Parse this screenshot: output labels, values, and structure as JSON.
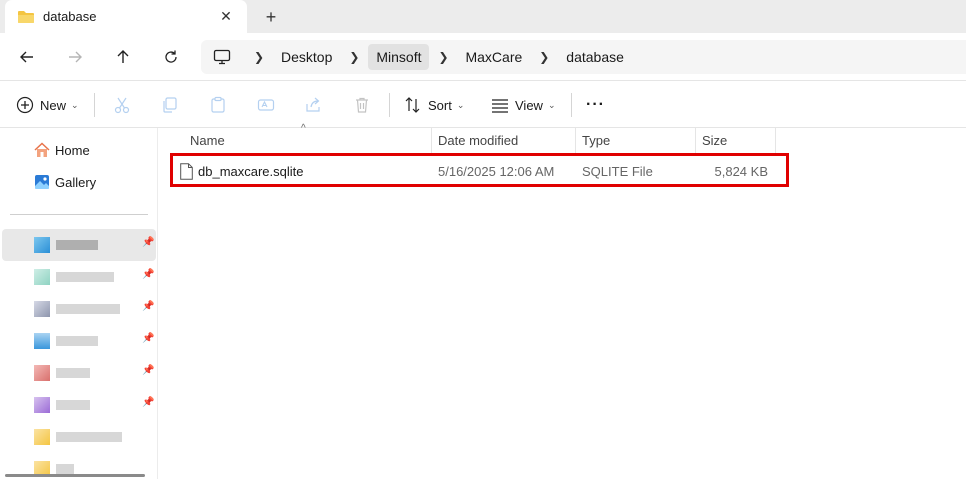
{
  "tab": {
    "title": "database",
    "close_icon": "close-icon",
    "new_tab_icon": "plus-icon"
  },
  "nav": {
    "back_icon": "arrow-left-icon",
    "forward_icon": "arrow-right-icon",
    "up_icon": "arrow-up-icon",
    "refresh_icon": "refresh-icon",
    "breadcrumbs": [
      "Desktop",
      "Minsoft",
      "MaxCare",
      "database"
    ]
  },
  "commands": {
    "new_label": "New",
    "sort_label": "Sort",
    "view_label": "View",
    "more_label": "···"
  },
  "sidebar": {
    "home_label": "Home",
    "gallery_label": "Gallery"
  },
  "columns": {
    "name": "Name",
    "date": "Date modified",
    "type": "Type",
    "size": "Size"
  },
  "files": [
    {
      "name": "db_maxcare.sqlite",
      "date": "5/16/2025 12:06 AM",
      "type": "SQLITE File",
      "size": "5,824 KB"
    }
  ],
  "colors": {
    "highlight": "#e00000",
    "folder": "#f4c542",
    "home": "#e8734a",
    "gallery": "#2b7bd6"
  }
}
